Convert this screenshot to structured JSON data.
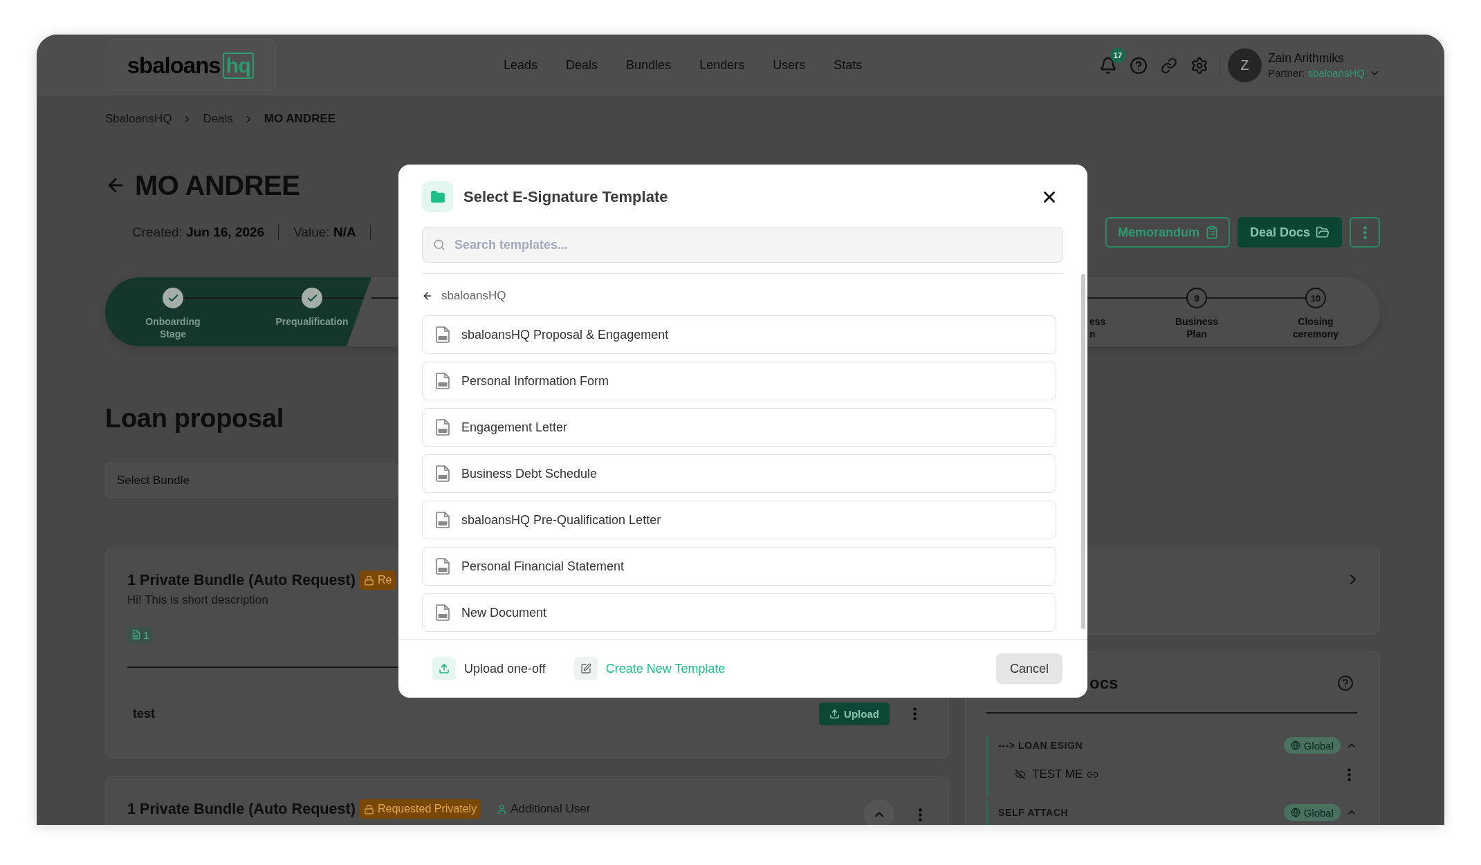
{
  "header": {
    "logo": {
      "text": "sbaloans",
      "badge": "hq"
    },
    "nav": [
      {
        "label": "Leads"
      },
      {
        "label": "Deals"
      },
      {
        "label": "Bundles"
      },
      {
        "label": "Lenders"
      },
      {
        "label": "Users"
      },
      {
        "label": "Stats"
      }
    ],
    "notifications": {
      "count": "17"
    },
    "user": {
      "initial": "Z",
      "name": "Zain Arithmiks",
      "role": "Partner:",
      "partner": "sbaloansHQ"
    }
  },
  "breadcrumb": [
    {
      "label": "SbaloansHQ",
      "current": false
    },
    {
      "label": "Deals",
      "current": false
    },
    {
      "label": "MO ANDREE",
      "current": true
    }
  ],
  "deal": {
    "title": "MO ANDREE",
    "meta": [
      "Created: **Jun 16, 2026**",
      "Value: **N/A**"
    ],
    "actions": [
      {
        "kind": "outline",
        "label": "Memorandum"
      },
      {
        "kind": "filled",
        "label": "Deal Docs"
      },
      {
        "kind": "more"
      }
    ]
  },
  "stepper": {
    "completed": [
      {
        "label": "Onboarding Stage",
        "done": true
      },
      {
        "label": "Prequalification",
        "done": true
      }
    ],
    "cut_label": "ess n",
    "upcoming": [
      {
        "number": "9",
        "label": "Business Plan",
        "done": false
      },
      {
        "number": "10",
        "label": "Closing ceremony",
        "done": false
      }
    ]
  },
  "loan_proposal": {
    "title": "Loan proposal",
    "bundle_select": {
      "placeholder": "Select Bundle"
    },
    "bundles": [
      {
        "title": "1 Private Bundle (Auto Request)",
        "status": "Re",
        "description": "Hi! This is short description",
        "doc_count": "1",
        "documents": [
          {
            "name": "test",
            "action": "Upload"
          }
        ]
      },
      {
        "title": "1 Private Bundle (Auto Request)",
        "status": "Requested Privately",
        "assignee": "Additional User",
        "expanded": true
      }
    ]
  },
  "docs_panel": {
    "title": "ocs",
    "groups": [
      {
        "title": "---> LOAN ESIGN",
        "scope": "Global",
        "expanded": true,
        "items": [
          {
            "name": "TEST ME"
          }
        ]
      },
      {
        "title": "SELF ATTACH",
        "scope": "Global",
        "expanded": true
      }
    ]
  },
  "modal": {
    "title": "Select E-Signature Template",
    "search": {
      "placeholder": "Search templates..."
    },
    "folder": "sbaloansHQ",
    "templates": [
      {
        "name": "sbaloansHQ Proposal & Engagement"
      },
      {
        "name": "Personal Information Form"
      },
      {
        "name": "Engagement Letter"
      },
      {
        "name": "Business Debt Schedule"
      },
      {
        "name": "sbaloansHQ Pre-Qualification Letter"
      },
      {
        "name": "Personal Financial Statement"
      },
      {
        "name": "New Document"
      }
    ],
    "footer": {
      "upload": "Upload one-off",
      "create": "Create New Template",
      "cancel": "Cancel"
    }
  }
}
